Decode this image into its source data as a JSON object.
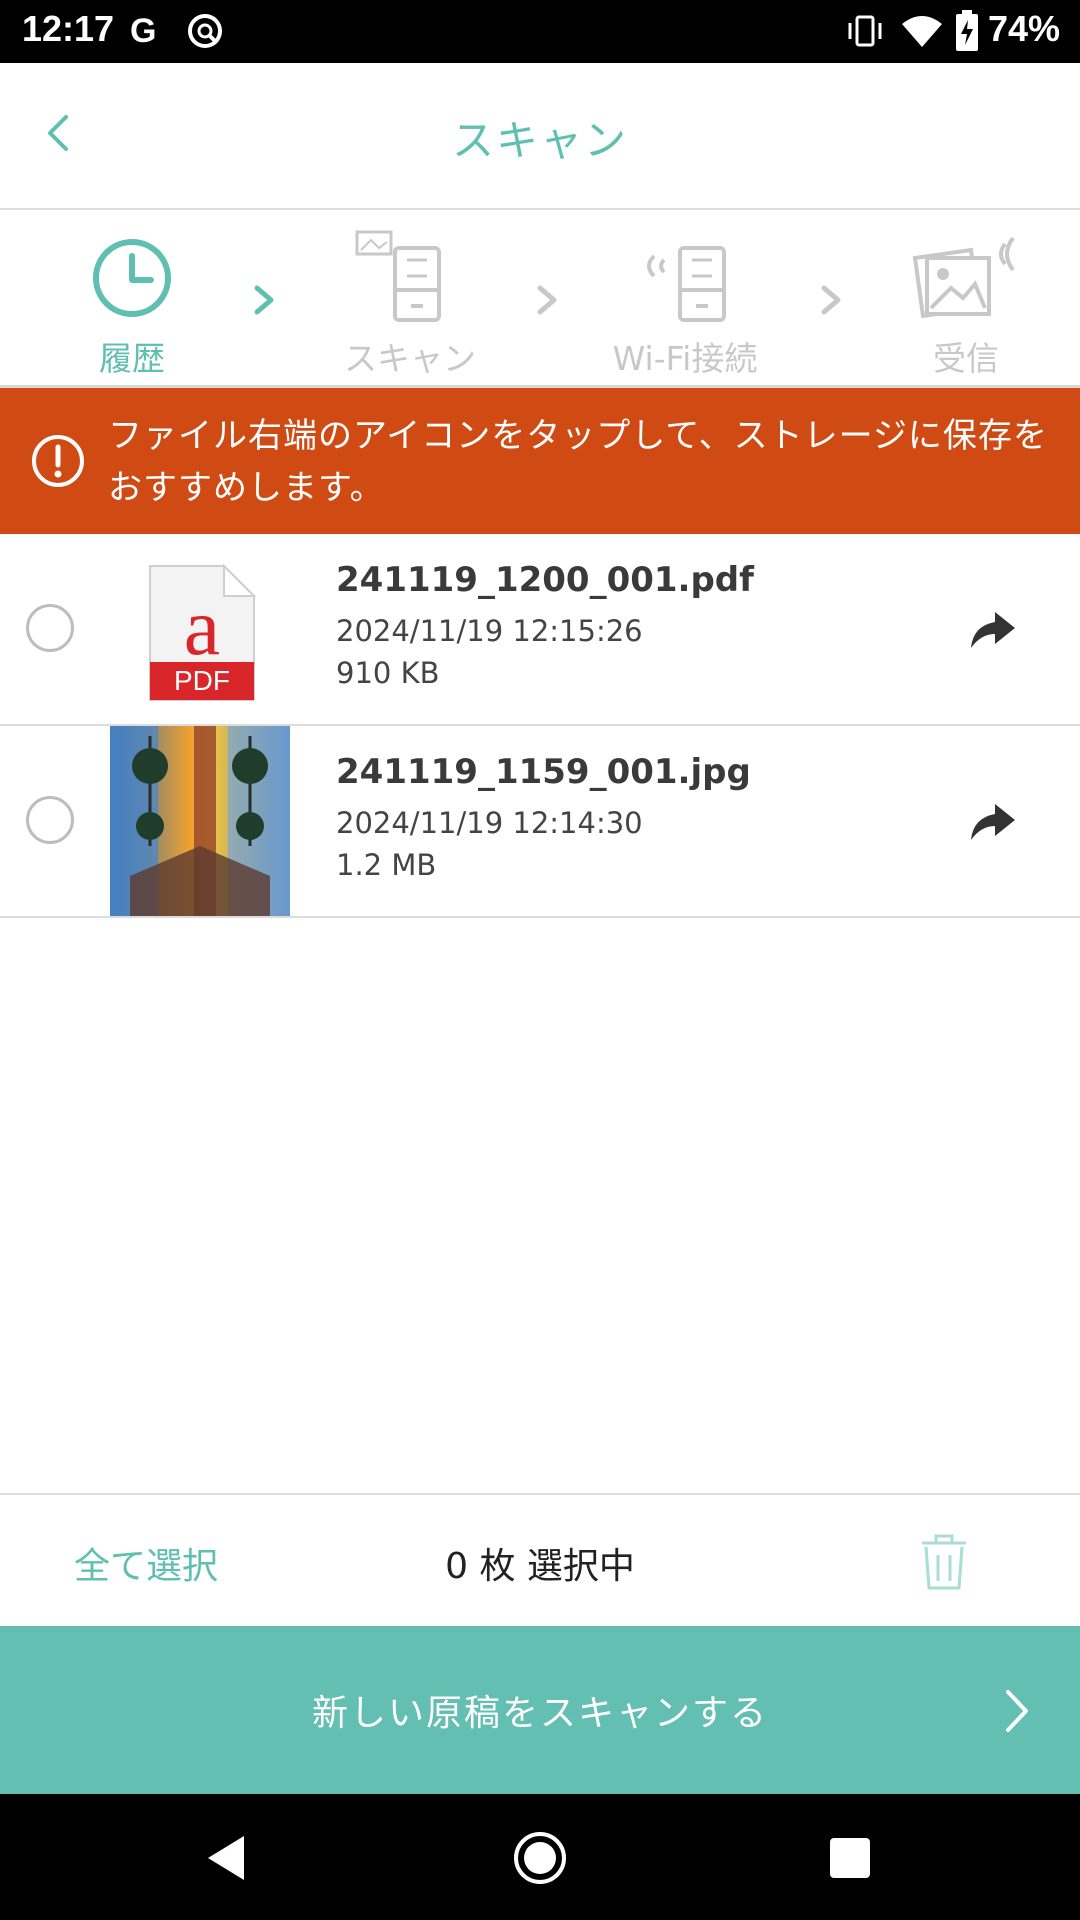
{
  "status_bar": {
    "time": "12:17",
    "battery": "74%",
    "icons": [
      "google-icon",
      "vpn-icon",
      "vibrate-icon",
      "wifi-icon",
      "battery-charging-icon"
    ]
  },
  "header": {
    "title": "スキャン",
    "back_icon": "back-chevron-icon"
  },
  "steps": [
    {
      "label": "履歴",
      "icon": "clock-icon",
      "active": true
    },
    {
      "label": "スキャン",
      "icon": "scanner-icon",
      "active": false
    },
    {
      "label": "Wi-Fi接続",
      "icon": "wifi-scanner-icon",
      "active": false
    },
    {
      "label": "受信",
      "icon": "receive-image-icon",
      "active": false
    }
  ],
  "banner": {
    "text": "ファイル右端のアイコンをタップして、ストレージに保存をおすすめします。",
    "color": "#d04a14"
  },
  "files": [
    {
      "name": "241119_1200_001.pdf",
      "date": "2024/11/19 12:15:26",
      "size": "910 KB",
      "type": "pdf",
      "thumb_label": "PDF"
    },
    {
      "name": "241119_1159_001.jpg",
      "date": "2024/11/19 12:14:30",
      "size": "1.2 MB",
      "type": "jpg"
    }
  ],
  "bottom_bar": {
    "select_all": "全て選択",
    "selected_count": "0 枚 選択中"
  },
  "primary_button": {
    "label": "新しい原稿をスキャンする"
  },
  "colors": {
    "accent": "#5fbfb0",
    "button": "#62bfb1",
    "warning": "#d04a14"
  }
}
